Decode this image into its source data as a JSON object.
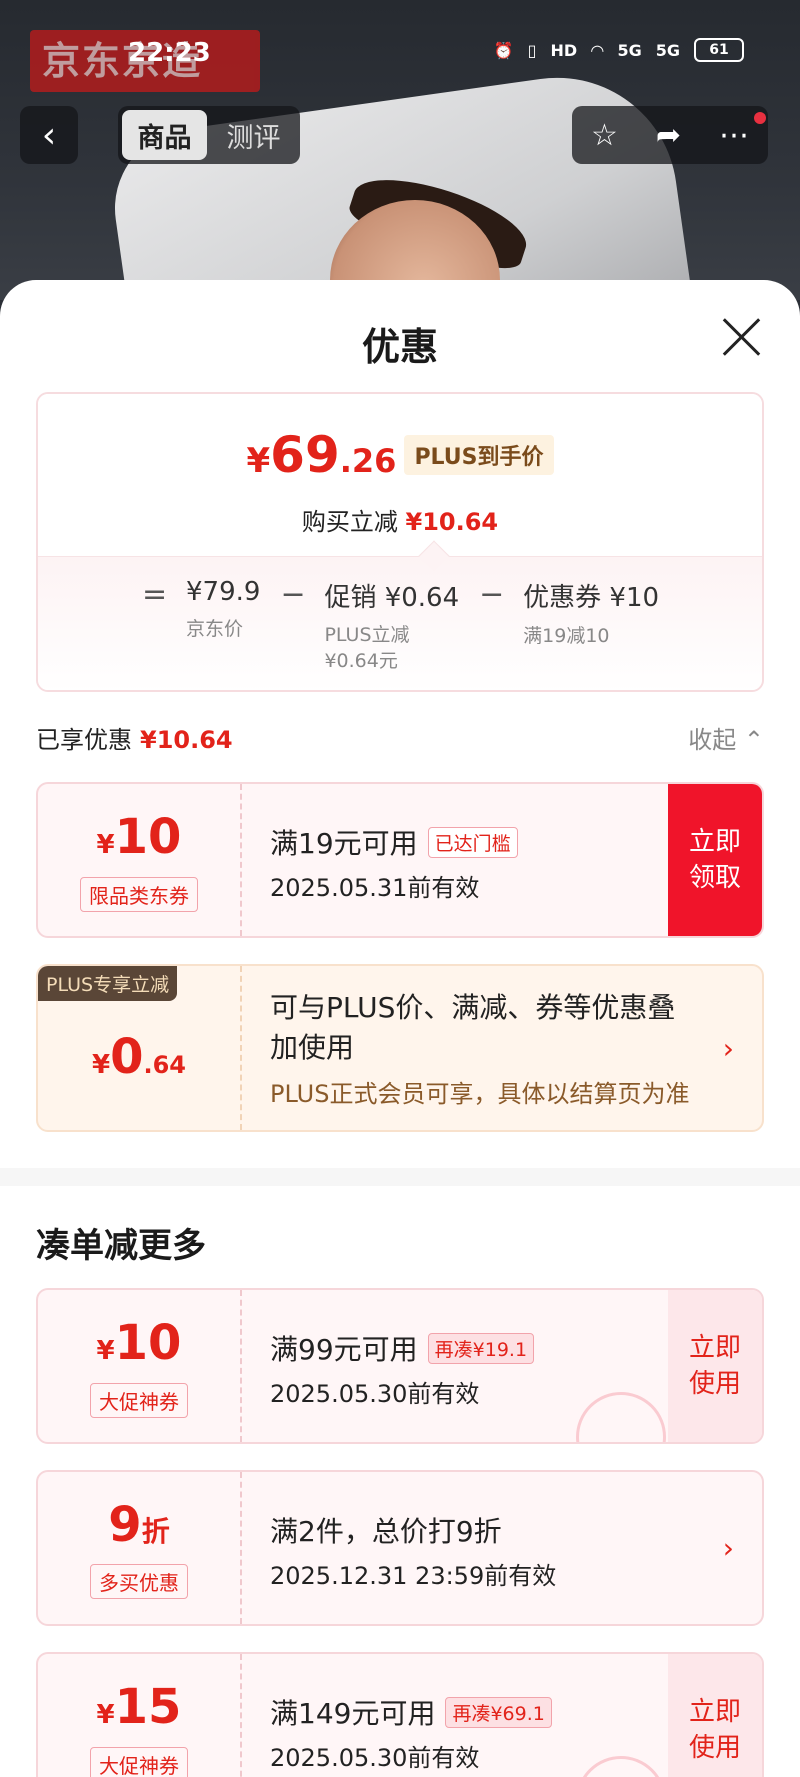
{
  "status": {
    "time": "22:23",
    "icons": [
      "alarm-icon",
      "vibrate-icon",
      "HD",
      "wifi-icon",
      "5G",
      "5G"
    ],
    "battery": "61"
  },
  "hero": {
    "brand": "京东京造"
  },
  "nav": {
    "back_icon": "chevron-left-icon",
    "tabs": [
      "商品",
      "测评"
    ],
    "active_tab": "商品",
    "actions": [
      "star-icon",
      "share-icon",
      "more-icon"
    ]
  },
  "sheet": {
    "title": "优惠",
    "price": {
      "currency": "¥",
      "integer": "69",
      "decimal": ".26",
      "plus_tag": "PLUS到手价",
      "reduce_label": "购买立减",
      "reduce_value": "¥10.64"
    },
    "formula": {
      "eq": "=",
      "jd_price": "¥79.9",
      "jd_price_label": "京东价",
      "minus1": "−",
      "promo": "促销 ¥0.64",
      "promo_sub1": "PLUS立减",
      "promo_sub2": "¥0.64元",
      "minus2": "−",
      "coupon": "优惠券 ¥10",
      "coupon_sub": "满19减10"
    },
    "enjoyed": {
      "label": "已享优惠",
      "value": "¥10.64",
      "collapse": "收起 ⌃"
    },
    "coupon1": {
      "currency": "¥",
      "amount": "10",
      "tag": "限品类东券",
      "condition": "满19元可用",
      "chip": "已达门槛",
      "valid": "2025.05.31前有效",
      "button": "立即领取"
    },
    "plus": {
      "badge": "PLUS专享立减",
      "currency": "¥",
      "integer": "0",
      "decimal": ".64",
      "desc": "可与PLUS价、满减、券等优惠叠加使用",
      "sub": "PLUS正式会员可享，具体以结算页为准"
    },
    "more_title": "凑单减更多",
    "coupon2": {
      "currency": "¥",
      "amount": "10",
      "tag": "大促神券",
      "condition": "满99元可用",
      "chip": "再凑¥19.1",
      "valid": "2025.05.30前有效",
      "button": "立即使用"
    },
    "coupon3": {
      "amount": "9",
      "unit": "折",
      "tag": "多买优惠",
      "condition": "满2件，总价打9折",
      "valid": "2025.12.31 23:59前有效"
    },
    "coupon4": {
      "currency": "¥",
      "amount": "15",
      "tag": "大促神券",
      "condition": "满149元可用",
      "chip": "再凑¥69.1",
      "valid": "2025.05.30前有效",
      "button": "立即使用"
    }
  },
  "colors": {
    "accent": "#e2231a",
    "button_red": "#f0142a",
    "plus_brown": "#5a4637"
  }
}
